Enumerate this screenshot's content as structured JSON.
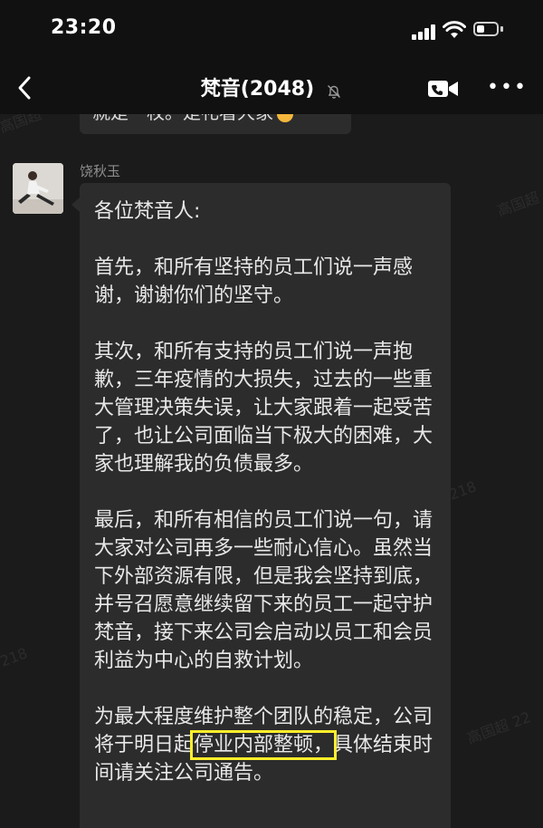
{
  "status_bar": {
    "time": "23:20"
  },
  "nav": {
    "title": "梵音(2048)"
  },
  "previous_message": {
    "text": "就是一枚。是礼看大家"
  },
  "sender": {
    "name": "饶秋玉"
  },
  "message": {
    "greeting": "各位梵音人:",
    "para1": "首先，和所有坚持的员工们说一声感谢，谢谢你们的坚守。",
    "para2": "其次，和所有支持的员工们说一声抱歉，三年疫情的大损失，过去的一些重大管理决策失误，让大家跟着一起受苦了，也让公司面临当下极大的困难，大家也理解我的负债最多。",
    "para3": "最后，和所有相信的员工们说一句，请大家对公司再多一些耐心信心。虽然当下外部资源有限，但是我会坚持到底，并号召愿意继续留下来的员工一起守护梵音，接下来公司会启动以员工和会员利益为中心的自救计划。",
    "para4_pre": "为最大程度维护整个团队的稳定，公司将于明日起",
    "para4_highlight": "停业内部整顿，",
    "para4_post": "具体结束时间请关注公司通告。"
  },
  "watermarks": [
    "高国超",
    "高国超",
    "218",
    "218",
    "高国超 22"
  ],
  "colors": {
    "highlight": "#ffef2b",
    "bubble": "#2c2c2c",
    "background": "#1b1b1b"
  }
}
